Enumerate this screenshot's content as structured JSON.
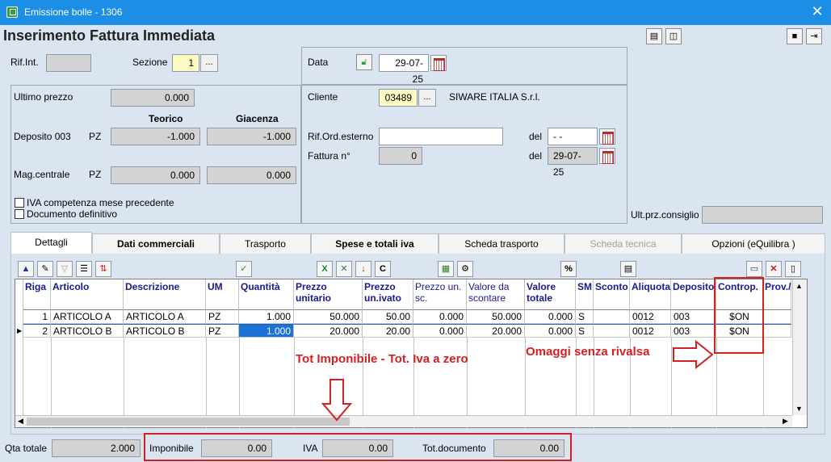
{
  "window": {
    "title": "Emissione bolle - 1306",
    "close_icon": "close-icon"
  },
  "page": {
    "title": "Inserimento Fattura Immediata"
  },
  "top": {
    "rif_int_label": "Rif.Int.",
    "sezione_label": "Sezione",
    "sezione_value": "1",
    "data_label": "Data",
    "data_value": "29-07-25"
  },
  "left_panel": {
    "ultimo_prezzo_label": "Ultimo prezzo",
    "ultimo_prezzo_value": "0.000",
    "teorico_label": "Teorico",
    "giacenza_label": "Giacenza",
    "deposito_label": "Deposito 003",
    "deposito_um": "PZ",
    "deposito_teorico": "-1.000",
    "deposito_giacenza": "-1.000",
    "mag_label": "Mag.centrale",
    "mag_um": "PZ",
    "mag_teorico": "0.000",
    "mag_giacenza": "0.000",
    "iva_label": "IVA competenza mese precedente",
    "doc_def_label": "Documento definitivo"
  },
  "right_panel": {
    "cliente_label": "Cliente",
    "cliente_code": "03489",
    "cliente_name": "SIWARE ITALIA S.r.l.",
    "rif_ord_label": "Rif.Ord.esterno",
    "rif_ord_value": "",
    "del_label": "del",
    "del1_value": "- -",
    "fattura_label": "Fattura n°",
    "fattura_value": "0",
    "del2_value": "29-07-25",
    "ult_prz_label": "Ult.prz.consiglio"
  },
  "tabs": [
    {
      "label": "Dettagli"
    },
    {
      "label": "Dati commerciali"
    },
    {
      "label": "Trasporto"
    },
    {
      "label": "Spese e totali iva"
    },
    {
      "label": "Scheda trasporto"
    },
    {
      "label": "Scheda tecnica"
    },
    {
      "label": "Opzioni (eQuilibra )"
    }
  ],
  "grid": {
    "columns": [
      "Riga",
      "Articolo",
      "Descrizione",
      "UM",
      "Quantità",
      "Prezzo unitario",
      "Prezzo un.ivato",
      "Prezzo un. sc.",
      "Valore da scontare",
      "Valore totale",
      "SM",
      "Sconto",
      "Aliquota",
      "Deposito",
      "Controp.",
      "Prov./"
    ],
    "rows": [
      [
        "1",
        "ARTICOLO A",
        "ARTICOLO A",
        "PZ",
        "1.000",
        "50.000",
        "50.00",
        "0.000",
        "50.000",
        "0.000",
        "S",
        "",
        "0012",
        "003",
        "$ON",
        ""
      ],
      [
        "2",
        "ARTICOLO B",
        "ARTICOLO B",
        "PZ",
        "1.000",
        "20.000",
        "20.00",
        "0.000",
        "20.000",
        "0.000",
        "S",
        "",
        "0012",
        "003",
        "$ON",
        ""
      ]
    ]
  },
  "annotations": {
    "tot_imponibile": "Tot Imponibile - Tot. Iva a zero",
    "omaggi": "Omaggi senza rivalsa"
  },
  "footer": {
    "qta_label": "Qta totale",
    "qta_value": "2.000",
    "imponibile_label": "Imponibile",
    "imponibile_value": "0.00",
    "iva_label": "IVA",
    "iva_value": "0.00",
    "totdoc_label": "Tot.documento",
    "totdoc_value": "0.00"
  },
  "colors": {
    "titlebar": "#1c8ee6",
    "annotation_red": "#d42020",
    "background": "#dbe5f1"
  }
}
